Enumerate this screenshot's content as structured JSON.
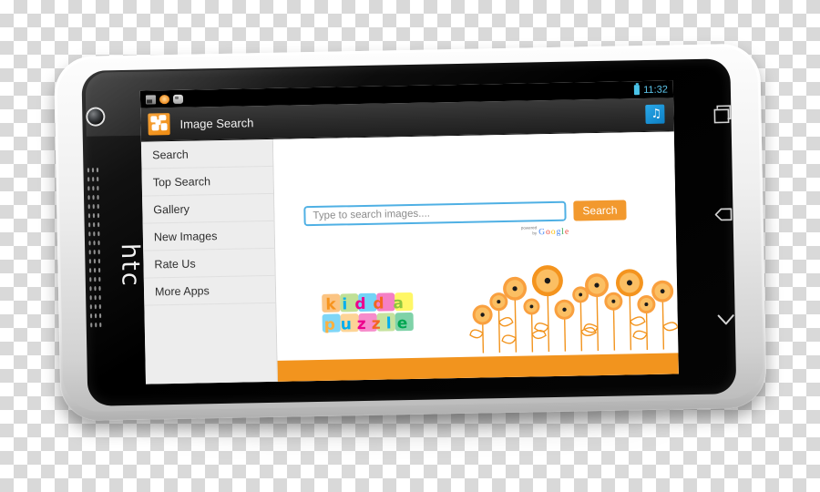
{
  "device": {
    "brand": "htc",
    "navkeys": [
      {
        "name": "recent-apps",
        "icon": "recent-apps-icon"
      },
      {
        "name": "back",
        "icon": "back-arrow-icon"
      },
      {
        "name": "home",
        "icon": "chevron-down-icon"
      }
    ]
  },
  "statusbar": {
    "time": "11:32",
    "notifications": [
      "screenshot-icon",
      "download-icon",
      "cloud-icon"
    ],
    "battery": "battery-icon"
  },
  "actionbar": {
    "title": "Image Search",
    "app_icon": "puzzle-icon",
    "music_icon": "music-note-icon"
  },
  "sidebar": {
    "items": [
      {
        "label": "Search"
      },
      {
        "label": "Top Search"
      },
      {
        "label": "Gallery"
      },
      {
        "label": "New Images"
      },
      {
        "label": "Rate Us"
      },
      {
        "label": "More Apps"
      }
    ]
  },
  "search": {
    "placeholder": "Type to search images....",
    "value": "",
    "button_label": "Search",
    "powered_by": {
      "line1": "powered",
      "line2": "by",
      "g1": "G",
      "o1": "o",
      "o2": "o",
      "g2": "g",
      "l": "l",
      "e": "e"
    }
  },
  "artwork": {
    "logo_text": "kidda puzzle",
    "logo_name": "kidda-puzzle-logo",
    "flowers_name": "sunflowers-illustration"
  },
  "colors": {
    "accent_orange": "#f2992e",
    "band_orange": "#f2941e",
    "input_border": "#4fb0e4",
    "sidebar_bg": "#ededed",
    "status_blue": "#5ec8ee"
  }
}
